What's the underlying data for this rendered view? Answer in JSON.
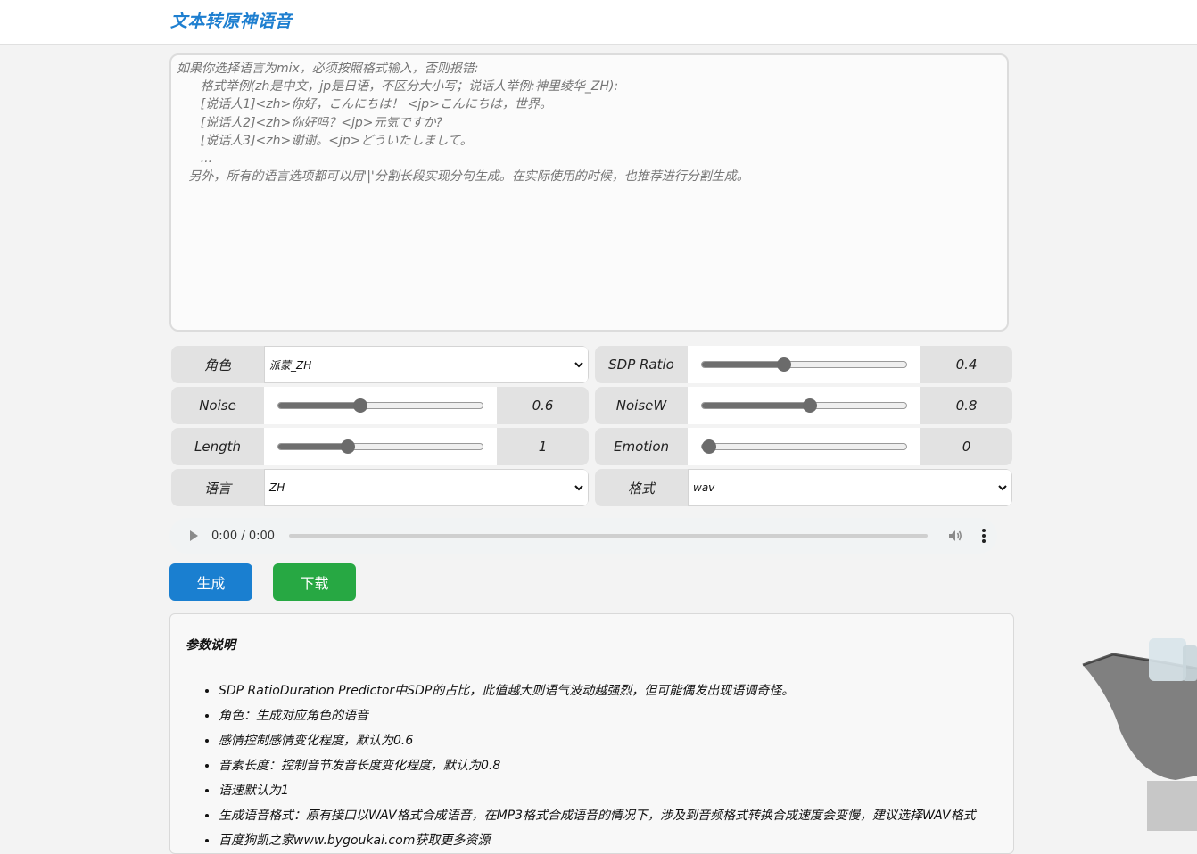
{
  "header": {
    "title": "文本转原神语音"
  },
  "textarea": {
    "placeholder": "如果你选择语言为mix，必须按照格式输入，否则报错:\n      格式举例(zh是中文，jp是日语，不区分大小写；说话人举例:神里绫华_ZH):\n      [说话人1]<zh>你好，こんにちは！ <jp>こんにちは，世界。\n      [说话人2]<zh>你好吗？<jp>元気ですか?\n      [说话人3]<zh>谢谢。<jp>どういたしまして。\n      ...\n   另外，所有的语言选项都可以用'|'分割长段实现分句生成。在实际使用的时候，也推荐进行分割生成。"
  },
  "controls": {
    "role": {
      "label": "角色",
      "value": "派蒙_ZH"
    },
    "sdp_ratio": {
      "label": "SDP Ratio",
      "value": "0.4",
      "fraction": 0.4
    },
    "noise": {
      "label": "Noise",
      "value": "0.6",
      "fraction": 0.4
    },
    "noisew": {
      "label": "NoiseW",
      "value": "0.8",
      "fraction": 0.53
    },
    "length": {
      "label": "Length",
      "value": "1",
      "fraction": 0.34
    },
    "emotion": {
      "label": "Emotion",
      "value": "0",
      "fraction": 0.0
    },
    "language": {
      "label": "语言",
      "value": "ZH"
    },
    "format": {
      "label": "格式",
      "value": "wav"
    }
  },
  "audio": {
    "time": "0:00 / 0:00"
  },
  "buttons": {
    "generate": "生成",
    "download": "下载"
  },
  "params": {
    "title": "参数说明",
    "items": [
      "SDP RatioDuration Predictor中SDP的占比，此值越大则语气波动越强烈，但可能偶发出现语调奇怪。",
      "角色：生成对应角色的语音",
      "感情控制感情变化程度，默认为0.6",
      "音素长度：控制音节发音长度变化程度，默认为0.8",
      "语速默认为1",
      "生成语音格式：原有接口以WAV格式合成语音，在MP3格式合成语音的情况下，涉及到音频格式转换合成速度会变慢，建议选择WAV格式",
      "百度狗凯之家www.bygoukai.com获取更多资源"
    ]
  },
  "colors": {
    "primary": "#1a7fd0",
    "success": "#27a843",
    "title": "#1e7fd0"
  }
}
